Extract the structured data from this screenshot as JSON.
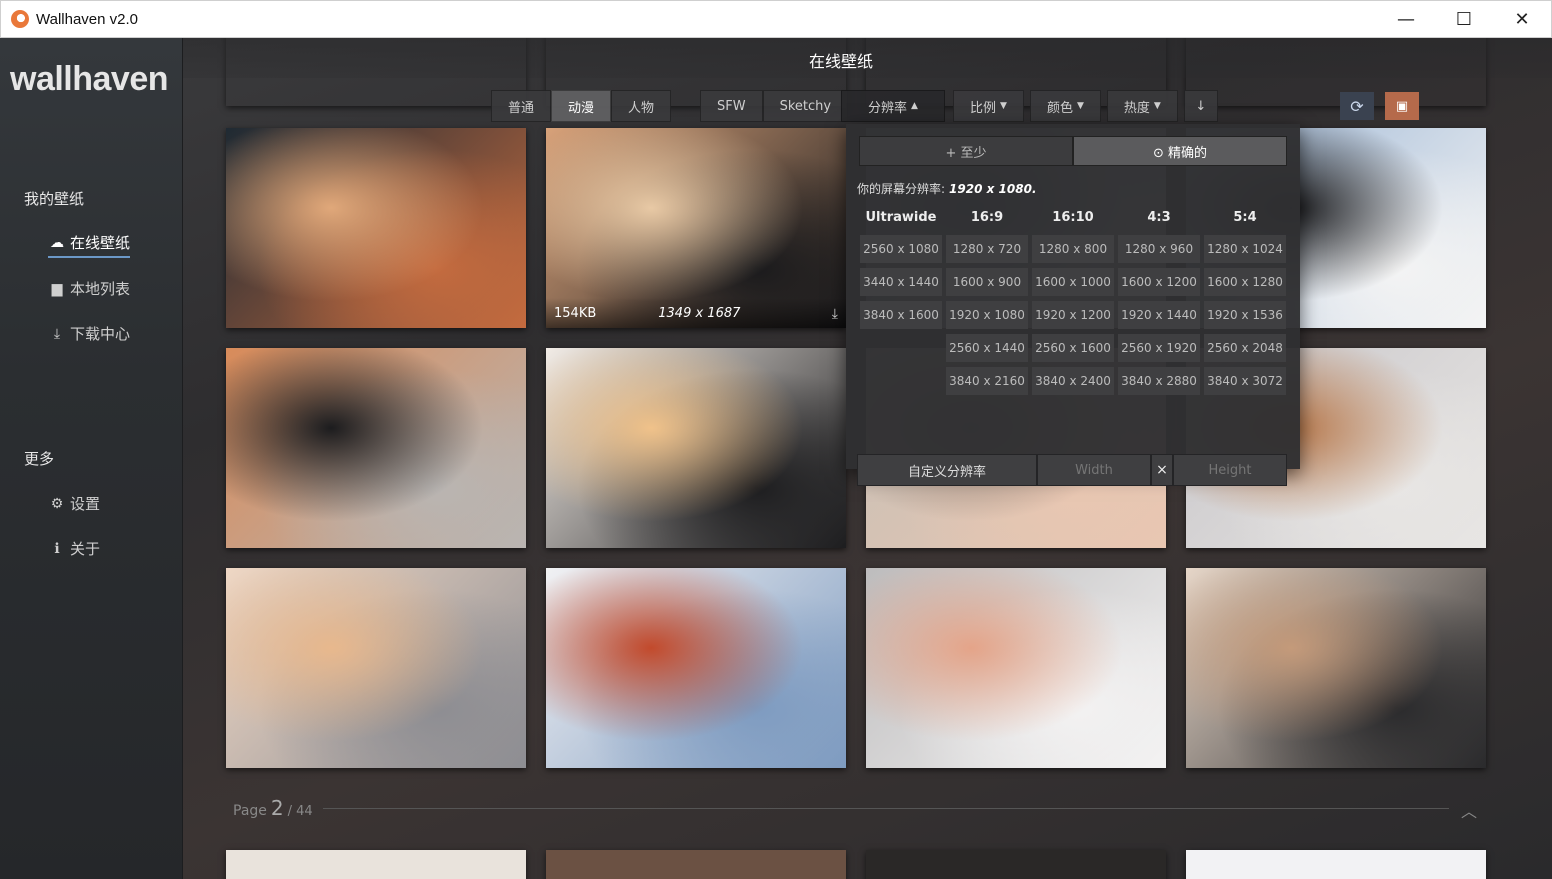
{
  "window": {
    "title": "Wallhaven v2.0",
    "controls": {
      "minimize": "—",
      "maximize": "☐",
      "close": "✕"
    }
  },
  "sidebar": {
    "logo": "wallhaven",
    "section_my": "我的壁纸",
    "items": [
      {
        "label": "在线壁纸",
        "icon": "cloud-icon",
        "glyph": "☁",
        "active": true
      },
      {
        "label": "本地列表",
        "icon": "folder-icon",
        "glyph": "▆",
        "active": false
      },
      {
        "label": "下载中心",
        "icon": "download-icon",
        "glyph": "⤓",
        "active": false
      }
    ],
    "section_more": "更多",
    "more_items": [
      {
        "label": "设置",
        "icon": "gear-icon",
        "glyph": "⚙"
      },
      {
        "label": "关于",
        "icon": "info-icon",
        "glyph": "ℹ"
      }
    ]
  },
  "header": {
    "title": "在线壁纸"
  },
  "filters": {
    "categories": [
      "普通",
      "动漫",
      "人物"
    ],
    "category_active": "动漫",
    "purity": [
      "SFW",
      "Sketchy"
    ],
    "resolution": "分辨率",
    "ratio": "比例",
    "color": "颜色",
    "sort": "热度",
    "order_icon": "↓",
    "refresh_icon": "⟳",
    "save_icon": "💾"
  },
  "resolution_panel": {
    "mode_atleast": "+ 至少",
    "mode_exact": "⊙ 精确的",
    "mode_active": "exact",
    "screen_label": "你的屏幕分辨率:",
    "screen_value": "1920 x 1080.",
    "columns": [
      {
        "header": "Ultrawide",
        "options": [
          "2560 x 1080",
          "3440 x 1440",
          "3840 x 1600"
        ]
      },
      {
        "header": "16:9",
        "options": [
          "1280 x 720",
          "1600 x 900",
          "1920 x 1080",
          "2560 x 1440",
          "3840 x 2160"
        ]
      },
      {
        "header": "16:10",
        "options": [
          "1280 x 800",
          "1600 x 1000",
          "1920 x 1200",
          "2560 x 1600",
          "3840 x 2400"
        ]
      },
      {
        "header": "4:3",
        "options": [
          "1280 x 960",
          "1600 x 1200",
          "1920 x 1440",
          "2560 x 1920",
          "3840 x 2880"
        ]
      },
      {
        "header": "5:4",
        "options": [
          "1280 x 1024",
          "1600 x 1280",
          "1920 x 1536",
          "2560 x 2048",
          "3840 x 3072"
        ]
      }
    ],
    "custom_label": "自定义分辨率",
    "width_placeholder": "Width",
    "height_placeholder": "Height",
    "separator": "×"
  },
  "thumbnails": [
    {
      "id": "t1",
      "palette": [
        "#1f2a33",
        "#c46b3f",
        "#e0a87a"
      ]
    },
    {
      "id": "t2",
      "palette": [
        "#d8a27a",
        "#1a1a1c",
        "#e8c9a5"
      ],
      "size": "154KB",
      "resolution": "1349 x 1687",
      "download_icon": "⤓"
    },
    {
      "id": "t3",
      "palette": [
        "#8b8f9a",
        "#d9dde6",
        "#4c5a70"
      ]
    },
    {
      "id": "t4",
      "palette": [
        "#9fb8d6",
        "#f4f4f4",
        "#1b1b1d"
      ]
    },
    {
      "id": "t5",
      "palette": [
        "#d88b5a",
        "#b9b5b2",
        "#1c1c1e"
      ]
    },
    {
      "id": "t6",
      "palette": [
        "#f2ece6",
        "#1d1d1f",
        "#f0c28a"
      ]
    },
    {
      "id": "t7",
      "palette": [
        "#c7bfb6",
        "#e9c7b2",
        "#8a7a70"
      ]
    },
    {
      "id": "t8",
      "palette": [
        "#c8c6c9",
        "#e8e6e4",
        "#b8794c"
      ]
    },
    {
      "id": "t9",
      "palette": [
        "#efd7c4",
        "#8d8d92",
        "#e8b88d"
      ]
    },
    {
      "id": "t10",
      "palette": [
        "#f1f1f3",
        "#7e9bc0",
        "#c24a2c"
      ]
    },
    {
      "id": "t11",
      "palette": [
        "#bdbcbd",
        "#f3f2f2",
        "#e4a489"
      ]
    },
    {
      "id": "t12",
      "palette": [
        "#e6d6c8",
        "#2a2a2c",
        "#c49a7a"
      ]
    }
  ],
  "pagination": {
    "label": "Page",
    "current": "2",
    "total": "/ 44",
    "up_icon": "︿"
  }
}
